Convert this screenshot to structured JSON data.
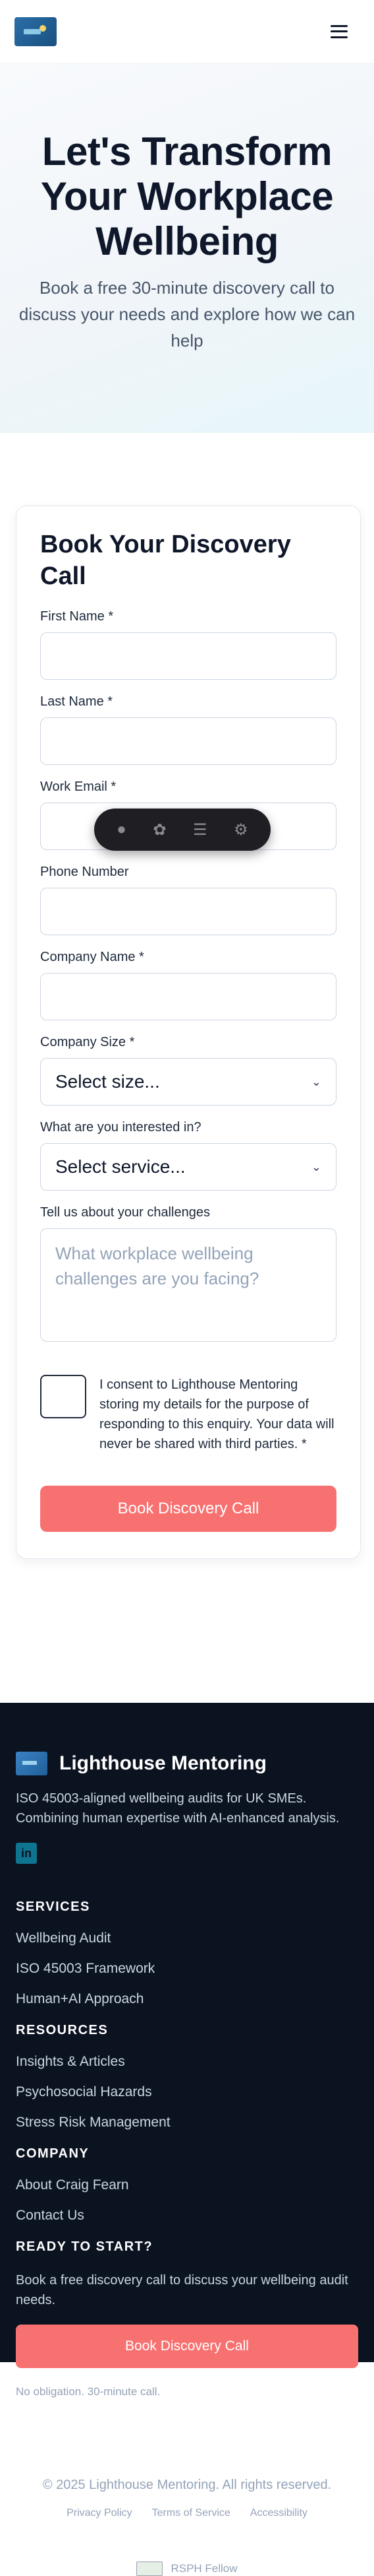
{
  "hero": {
    "title": "Let's Transform Your Workplace Wellbeing",
    "subtitle": "Book a free 30-minute discovery call to discuss your needs and explore how we can help"
  },
  "form": {
    "title": "Book Your Discovery Call",
    "fields": {
      "first_name": "First Name *",
      "last_name": "Last Name *",
      "work_email": "Work Email *",
      "phone": "Phone Number",
      "company_name": "Company Name *",
      "company_size": "Company Size *",
      "interest": "What are you interested in?",
      "challenges": "Tell us about your challenges"
    },
    "company_size_value": "Select size...",
    "interest_value": "Select service...",
    "challenges_placeholder": "What workplace wellbeing challenges are you facing?",
    "consent": "I consent to Lighthouse Mentoring storing my details for the purpose of responding to this enquiry. Your data will never be shared with third parties. *",
    "submit": "Book Discovery Call"
  },
  "toolbar_icons": [
    "drop-icon",
    "settings-icon",
    "list-icon",
    "gear-icon"
  ],
  "footer": {
    "brand": "Lighthouse Mentoring",
    "description": "ISO 45003-aligned wellbeing audits for UK SMEs. Combining human expertise with AI-enhanced analysis.",
    "linkedin": "in",
    "services": {
      "heading": "SERVICES",
      "links": [
        "Wellbeing Audit",
        "ISO 45003 Framework",
        "Human+AI Approach"
      ]
    },
    "resources": {
      "heading": "RESOURCES",
      "links": [
        "Insights & Articles",
        "Psychosocial Hazards",
        "Stress Risk Management"
      ]
    },
    "company": {
      "heading": "COMPANY",
      "links": [
        "About Craig Fearn",
        "Contact Us"
      ]
    },
    "cta": {
      "heading": "READY TO START?",
      "text": "Book a free discovery call to discuss your wellbeing audit needs.",
      "button": "Book Discovery Call",
      "note": "No obligation. 30-minute call."
    },
    "copyright": "© 2025 Lighthouse Mentoring. All rights reserved.",
    "legal_links": [
      "Privacy Policy",
      "Terms of Service",
      "Accessibility"
    ],
    "badge": "RSPH Fellow"
  },
  "colors": {
    "accent": "#f87171",
    "footer_bg": "#0b1220"
  }
}
